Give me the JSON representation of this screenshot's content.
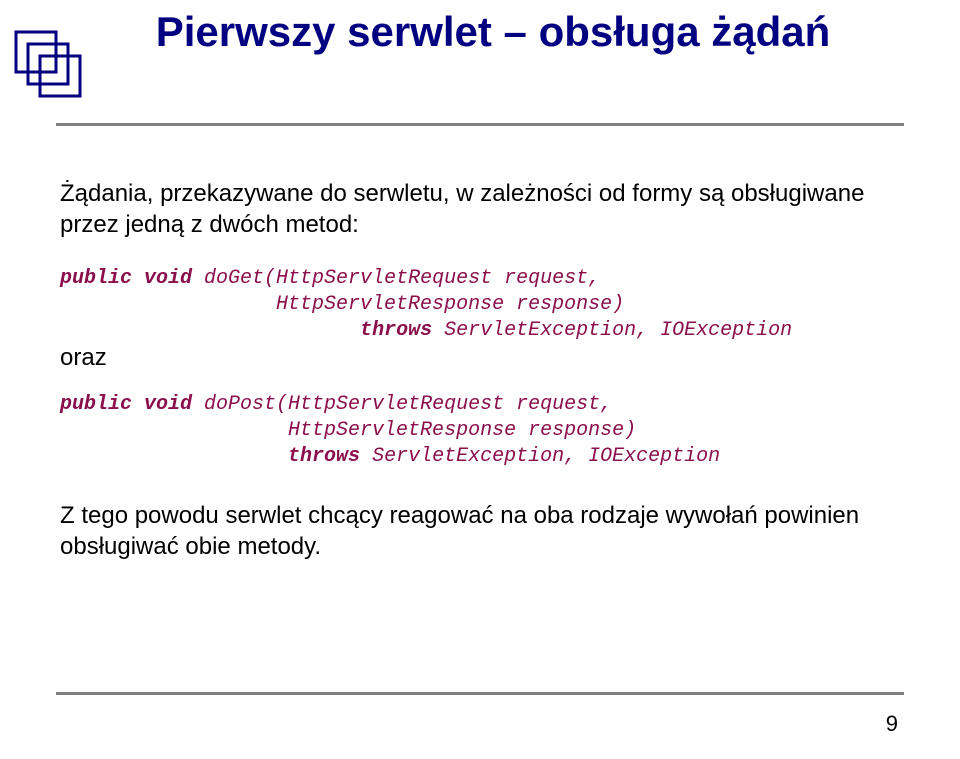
{
  "title": "Pierwszy serwlet – obsługa żądań",
  "intro": "Żądania, przekazywane do serwletu, w zależności od formy są obsługiwane przez jedną z dwóch metod:",
  "code1": {
    "kw1": "public void",
    "sig": " doGet(HttpServletRequest request,",
    "line2": "                  HttpServletResponse response)",
    "indent3": "                         ",
    "kw3": "throws",
    "rest3": " ServletException, IOException"
  },
  "and": "oraz",
  "code2": {
    "kw1": "public void",
    "sig": " doPost(HttpServletRequest request,",
    "line2": "                   HttpServletResponse response)",
    "indent3": "                   ",
    "kw3": "throws",
    "rest3": " ServletException, IOException"
  },
  "outro": "Z tego powodu serwlet chcący reagować na oba rodzaje wywołań powinien obsługiwać obie metody.",
  "page_number": "9"
}
